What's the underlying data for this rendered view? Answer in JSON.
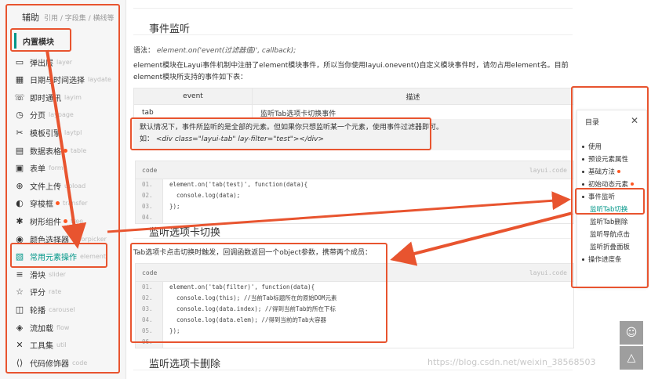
{
  "sidebar": {
    "header": "辅助",
    "header_sub": "引用 / 字段集 / 横线等",
    "group": "内置模块",
    "items": [
      {
        "label": "弹出层",
        "en": "layer",
        "icon": "window-icon",
        "dot": false
      },
      {
        "label": "日期与时间选择",
        "en": "laydate",
        "icon": "calendar-icon",
        "dot": false
      },
      {
        "label": "即时通讯",
        "en": "layim",
        "icon": "chat-icon",
        "dot": false
      },
      {
        "label": "分页",
        "en": "laypage",
        "icon": "pagination-icon",
        "dot": false
      },
      {
        "label": "模板引擎",
        "en": "laytpl",
        "icon": "template-icon",
        "dot": false
      },
      {
        "label": "数据表格",
        "en": "table",
        "icon": "table-icon",
        "dot": true
      },
      {
        "label": "表单",
        "en": "form",
        "icon": "form-icon",
        "dot": false
      },
      {
        "label": "文件上传",
        "en": "upload",
        "icon": "upload-icon",
        "dot": false
      },
      {
        "label": "穿梭框",
        "en": "transfer",
        "icon": "transfer-icon",
        "dot": true
      },
      {
        "label": "树形组件",
        "en": "tree",
        "icon": "tree-icon",
        "dot": true
      },
      {
        "label": "颜色选择器",
        "en": "colorpicker",
        "icon": "palette-icon",
        "dot": false
      },
      {
        "label": "常用元素操作",
        "en": "element",
        "icon": "element-icon",
        "dot": false,
        "active": true
      },
      {
        "label": "滑块",
        "en": "slider",
        "icon": "slider-icon",
        "dot": false
      },
      {
        "label": "评分",
        "en": "rate",
        "icon": "star-icon",
        "dot": false
      },
      {
        "label": "轮播",
        "en": "carousel",
        "icon": "carousel-icon",
        "dot": false
      },
      {
        "label": "流加载",
        "en": "flow",
        "icon": "flow-icon",
        "dot": false
      },
      {
        "label": "工具集",
        "en": "util",
        "icon": "tools-icon",
        "dot": false
      },
      {
        "label": "代码修饰器",
        "en": "code",
        "icon": "code-icon",
        "dot": false
      }
    ]
  },
  "main": {
    "section1_title": "事件监听",
    "syntax_label": "语法：",
    "syntax_code": "element.on('event(过滤器值)', callback);",
    "desc": "element模块在Layui事件机制中注册了element模块事件，所以当你使用layui.onevent()自定义模块事件时，请勿占用element名。目前element模块所支持的事件如下表：",
    "table": {
      "headers": [
        "event",
        "描述"
      ],
      "rows": [
        [
          "tab",
          "监听Tab选项卡切换事件"
        ]
      ]
    },
    "tip_line1": "默认情况下，事件所监听的是全部的元素。但如果你只想监听某一个元素，使用事件过滤器即可。",
    "tip_line2_prefix": "如：",
    "tip_line2_code": "<div class=\"layui-tab\" lay-filter=\"test\"></div>",
    "code1": {
      "label": "code",
      "brand": "layui.code",
      "lines": [
        {
          "no": "01.",
          "text": "element.on('tab(test)', function(data){"
        },
        {
          "no": "02.",
          "text": "  console.log(data);"
        },
        {
          "no": "03.",
          "text": "});"
        },
        {
          "no": "04.",
          "text": ""
        }
      ]
    },
    "section2_title": "监听选项卡切换",
    "section2_desc": "Tab选项卡点击切换时触发，回调函数返回一个object参数，携带两个成员：",
    "code2": {
      "label": "code",
      "brand": "layui.code",
      "lines": [
        {
          "no": "01.",
          "text": "element.on('tab(filter)', function(data){"
        },
        {
          "no": "02.",
          "text": "  console.log(this); //当前Tab标题所在的原始DOM元素"
        },
        {
          "no": "03.",
          "text": "  console.log(data.index); //得到当前Tab的所在下标"
        },
        {
          "no": "04.",
          "text": "  console.log(data.elem); //得到当前的Tab大容器"
        },
        {
          "no": "05.",
          "text": "});"
        },
        {
          "no": "06.",
          "text": ""
        }
      ]
    },
    "section3_title": "监听选项卡删除"
  },
  "toc": {
    "title": "目录",
    "close": "✕",
    "items": [
      {
        "label": "使用",
        "level": 1,
        "dot": false
      },
      {
        "label": "预设元素属性",
        "level": 1,
        "dot": false
      },
      {
        "label": "基础方法",
        "level": 1,
        "dot": true
      },
      {
        "label": "初始动态元素",
        "level": 1,
        "dot": true
      },
      {
        "label": "事件监听",
        "level": 1,
        "dot": false
      },
      {
        "label": "监听Tab切换",
        "level": 2,
        "dot": false,
        "active": true
      },
      {
        "label": "监听Tab删除",
        "level": 2,
        "dot": false
      },
      {
        "label": "监听导航点击",
        "level": 2,
        "dot": false
      },
      {
        "label": "监听折叠面板",
        "level": 2,
        "dot": false
      },
      {
        "label": "操作进度条",
        "level": 1,
        "dot": false
      }
    ]
  },
  "fabs": {
    "top_icon": "☺",
    "bottom_icon": "△"
  },
  "watermark": "https://blog.csdn.net/weixin_38568503",
  "colors": {
    "accent": "#009688",
    "annotation": "#e8542f",
    "dot": "#FF5722"
  }
}
